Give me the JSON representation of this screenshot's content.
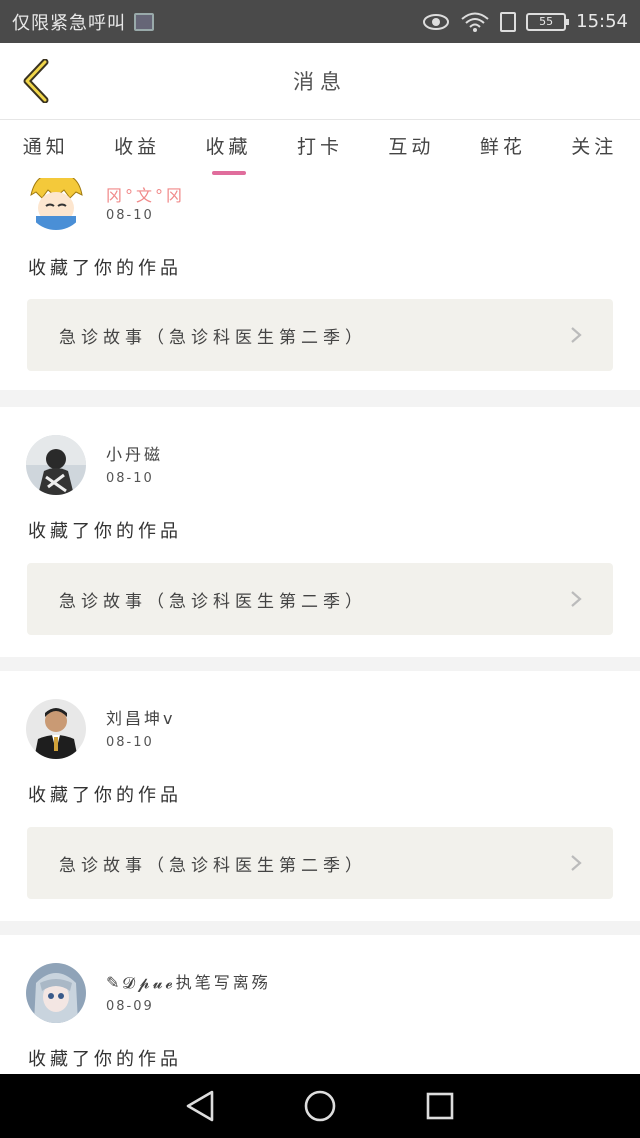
{
  "status_bar": {
    "left_text": "仅限紧急呼叫",
    "battery": "55",
    "time": "15:54"
  },
  "header": {
    "title": "消息"
  },
  "tabs": [
    {
      "label": "通知",
      "active": false
    },
    {
      "label": "收益",
      "active": false
    },
    {
      "label": "收藏",
      "active": true
    },
    {
      "label": "打卡",
      "active": false
    },
    {
      "label": "互动",
      "active": false
    },
    {
      "label": "鲜花",
      "active": false
    },
    {
      "label": "关注",
      "active": false
    }
  ],
  "notifications": [
    {
      "name": "冈°文°冈",
      "date": "08-10",
      "action": "收藏了你的作品",
      "work": "急诊故事（急诊科医生第二季）"
    },
    {
      "name": "小丹磁",
      "date": "08-10",
      "action": "收藏了你的作品",
      "work": "急诊故事（急诊科医生第二季）"
    },
    {
      "name": "刘昌坤v",
      "date": "08-10",
      "action": "收藏了你的作品",
      "work": "急诊故事（急诊科医生第二季）"
    },
    {
      "name": "✎𝓓𝓹𝓾𝓮执笔写离殇",
      "date": "08-09",
      "action": "收藏了你的作品",
      "work": ""
    }
  ],
  "colors": {
    "accent": "#e06d9c",
    "status_bar": "#4a4a4a",
    "card_link_bg": "#f2f1ec"
  }
}
